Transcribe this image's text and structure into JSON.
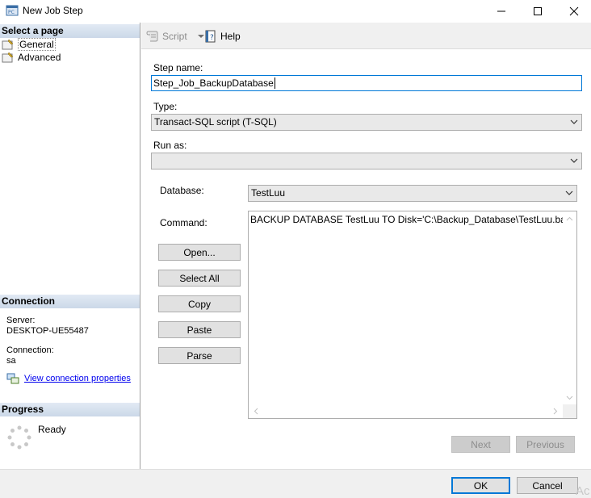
{
  "window": {
    "title": "New Job Step"
  },
  "left": {
    "select_page_header": "Select a page",
    "pages": [
      {
        "label": "General"
      },
      {
        "label": "Advanced"
      }
    ],
    "connection_header": "Connection",
    "server_label": "Server:",
    "server_value": "DESKTOP-UE55487",
    "connection_label": "Connection:",
    "connection_value": "sa",
    "view_props_link": "View connection properties",
    "progress_header": "Progress",
    "progress_status": "Ready"
  },
  "toolbar": {
    "script_label": "Script",
    "help_label": "Help"
  },
  "form": {
    "step_name_label": "Step name:",
    "step_name_value": "Step_Job_BackupDatabase",
    "type_label": "Type:",
    "type_value": "Transact-SQL script (T-SQL)",
    "run_as_label": "Run as:",
    "run_as_value": "",
    "database_label": "Database:",
    "database_value": "TestLuu",
    "command_label": "Command:",
    "command_value": "BACKUP DATABASE TestLuu TO Disk='C:\\Backup_Database\\TestLuu.bak'"
  },
  "command_buttons": {
    "open": "Open...",
    "select_all": "Select All",
    "copy": "Copy",
    "paste": "Paste",
    "parse": "Parse"
  },
  "nav": {
    "next": "Next",
    "previous": "Previous"
  },
  "footer": {
    "ok": "OK",
    "cancel": "Cancel",
    "watermark": "Ac"
  }
}
